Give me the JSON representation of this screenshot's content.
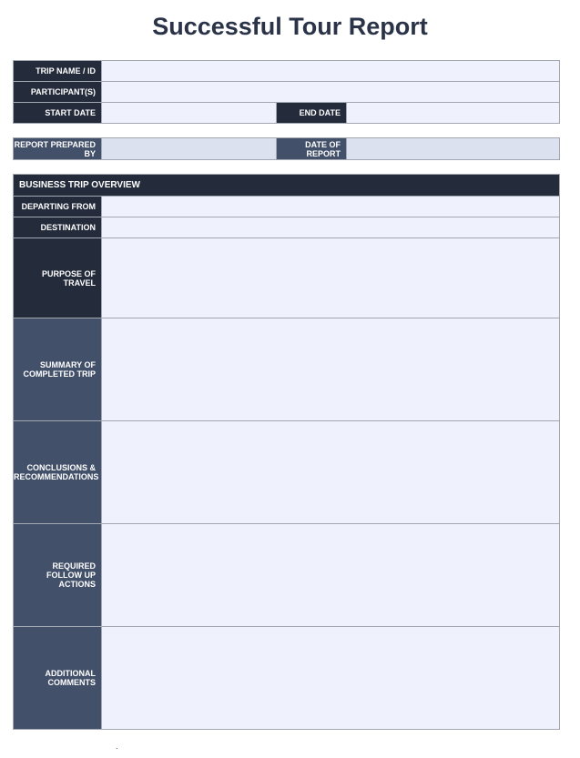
{
  "title": "Successful Tour Report",
  "trip_info": {
    "trip_name_label": "TRIP NAME / ID",
    "participants_label": "PARTICIPANT(S)",
    "start_date_label": "START DATE",
    "end_date_label": "END DATE"
  },
  "report": {
    "prepared_by_label": "REPORT PREPARED BY",
    "date_of_report_label": "DATE OF REPORT"
  },
  "overview": {
    "header": "BUSINESS TRIP OVERVIEW",
    "departing_from_label": "DEPARTING FROM",
    "destination_label": "DESTINATION",
    "purpose_label": "PURPOSE OF TRAVEL",
    "summary_label": [
      "SUMMARY OF",
      "COMPLETED TRIP"
    ],
    "conclusions_label": [
      "CONCLUSIONS &",
      "RECOMMENDATIONS"
    ],
    "follow_up_label": [
      "REQUIRED",
      "FOLLOW UP",
      "ACTIONS"
    ],
    "comments_label": [
      "ADDITIONAL",
      "COMMENTS"
    ]
  },
  "footer_mark": "."
}
